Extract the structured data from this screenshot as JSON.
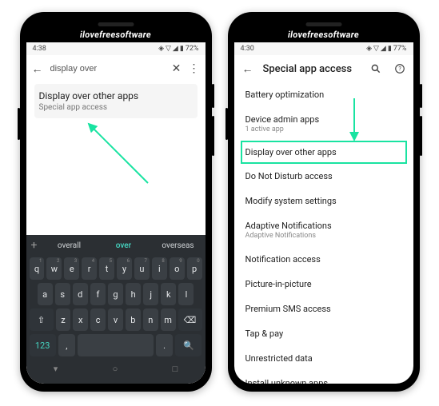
{
  "brand": "ilovefreesoftware",
  "left": {
    "status": {
      "time": "4:38",
      "battery": "72%"
    },
    "search": {
      "value": "display over"
    },
    "result": {
      "title": "Display over other apps",
      "subtitle": "Special app access"
    },
    "suggestions": {
      "a": "overall",
      "b": "over",
      "c": "overseas"
    },
    "keys": {
      "row1": [
        "q",
        "w",
        "e",
        "r",
        "t",
        "y",
        "u",
        "i",
        "o",
        "p"
      ],
      "row1sup": [
        "1",
        "2",
        "3",
        "4",
        "5",
        "6",
        "7",
        "8",
        "9",
        "0"
      ],
      "row2": [
        "a",
        "s",
        "d",
        "f",
        "g",
        "h",
        "j",
        "k",
        "l"
      ],
      "row3": [
        "z",
        "x",
        "c",
        "v",
        "b",
        "n",
        "m"
      ],
      "numkey": "123",
      "comma": ",",
      "period": "."
    }
  },
  "right": {
    "status": {
      "time": "4:30",
      "battery": "77%"
    },
    "title": "Special app access",
    "items": [
      {
        "title": "Battery optimization",
        "sub": ""
      },
      {
        "title": "Device admin apps",
        "sub": "1 active app"
      },
      {
        "title": "Display over other apps",
        "sub": "",
        "highlight": true
      },
      {
        "title": "Do Not Disturb access",
        "sub": ""
      },
      {
        "title": "Modify system settings",
        "sub": ""
      },
      {
        "title": "Adaptive Notifications",
        "sub": "Adaptive Notifications"
      },
      {
        "title": "Notification access",
        "sub": ""
      },
      {
        "title": "Picture-in-picture",
        "sub": ""
      },
      {
        "title": "Premium SMS access",
        "sub": ""
      },
      {
        "title": "Tap & pay",
        "sub": ""
      },
      {
        "title": "Unrestricted data",
        "sub": ""
      },
      {
        "title": "Install unknown apps",
        "sub": ""
      }
    ]
  }
}
